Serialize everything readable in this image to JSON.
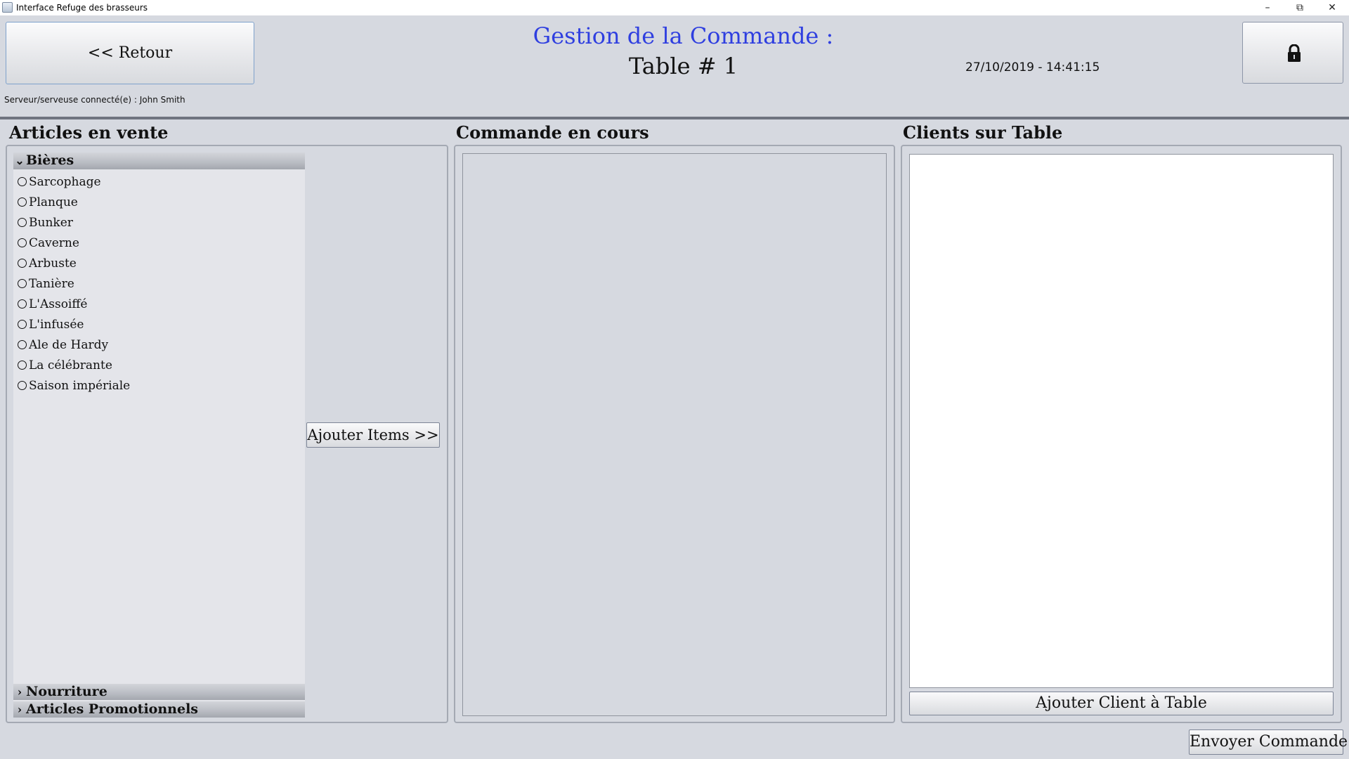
{
  "window": {
    "title": "Interface Refuge des brasseurs",
    "minimize": "–",
    "restore": "⧉",
    "close": "✕"
  },
  "header": {
    "back_label": "<< Retour",
    "heading": "Gestion de la Commande :",
    "table_label": "Table # 1",
    "datetime": "27/10/2019 - 14:41:15",
    "server_text": "Serveur/serveuse connecté(e) : John Smith",
    "lock_icon": "lock-icon"
  },
  "articles": {
    "title": "Articles en vente",
    "categories": [
      {
        "name": "Bières",
        "expanded": true,
        "items": [
          "Sarcophage",
          "Planque",
          "Bunker",
          "Caverne",
          "Arbuste",
          "Tanière",
          "L'Assoiffé",
          "L'infusée",
          "Ale de Hardy",
          "La célébrante",
          "Saison impériale"
        ]
      },
      {
        "name": "Nourriture",
        "expanded": false
      },
      {
        "name": "Articles Promotionnels",
        "expanded": false
      }
    ],
    "add_items_label": "Ajouter Items >>"
  },
  "order": {
    "title": "Commande en cours"
  },
  "clients": {
    "title": "Clients sur Table",
    "add_client_label": "Ajouter Client à Table"
  },
  "footer": {
    "send_label": "Envoyer Commande"
  },
  "colors": {
    "background": "#d6d9e0",
    "heading_blue": "#2f3fe0",
    "divider": "#6f7480"
  }
}
